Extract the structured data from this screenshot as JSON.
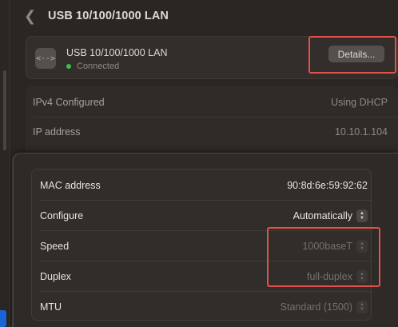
{
  "header": {
    "title": "USB 10/100/1000 LAN"
  },
  "network": {
    "name": "USB 10/100/1000 LAN",
    "status": "Connected",
    "status_color": "#34c24a",
    "details_label": "Details...",
    "icon": "ethernet-icon"
  },
  "info_rows": [
    {
      "label": "IPv4 Configured",
      "value": "Using DHCP"
    },
    {
      "label": "IP address",
      "value": "10.10.1.104"
    }
  ],
  "sheet": {
    "rows": [
      {
        "label": "MAC address",
        "value": "90:8d:6e:59:92:62"
      },
      {
        "label": "Configure",
        "value": "Automatically"
      },
      {
        "label": "Speed",
        "value": "1000baseT"
      },
      {
        "label": "Duplex",
        "value": "full-duplex"
      },
      {
        "label": "MTU",
        "value": "Standard (1500)"
      }
    ]
  },
  "colors": {
    "highlight": "#e0524a",
    "accent_blue": "#1a64d8"
  }
}
